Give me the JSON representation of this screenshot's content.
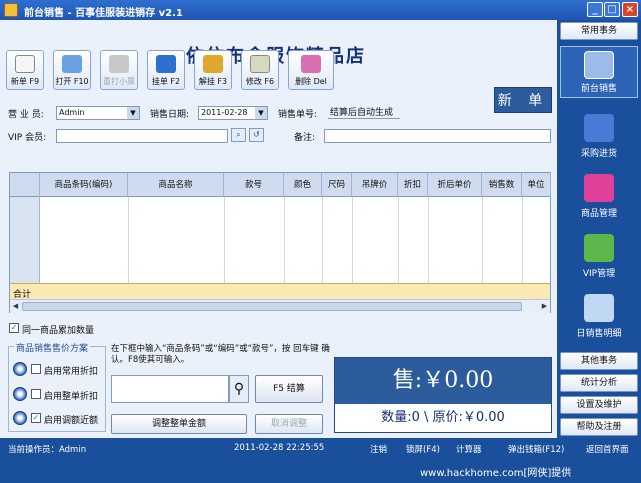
{
  "window": {
    "title": "前台销售 - 百事佳服装进销存 v2.1"
  },
  "shop_title": "依依布舍服饰精品店",
  "new_bill": "新 单",
  "toolbar": {
    "new": "新单 F9",
    "open": "打开 F10",
    "reprint": "重打小票",
    "hold": "挂单 F2",
    "unhold": "解挂 F3",
    "edit": "修改 F6",
    "delete": "删除 Del"
  },
  "form": {
    "salesperson_label": "营 业 员:",
    "salesperson_value": "Admin",
    "date_label": "销售日期:",
    "date_value": "2011-02-28",
    "bill_no_label": "销售单号:",
    "bill_no_value": "结算后自动生成",
    "vip_label": "VIP 会员:",
    "vip_value": "",
    "note_label": "备注:",
    "note_value": ""
  },
  "table": {
    "columns": [
      "商品条码(编码)",
      "商品名称",
      "款号",
      "颜色",
      "尺码",
      "吊牌价",
      "折扣",
      "折后单价",
      "销售数",
      "单位"
    ],
    "total_label": "合计"
  },
  "same_item_add": "同一商品累加数量",
  "scheme": {
    "title": "商品销售售价方案",
    "options": [
      {
        "label": "启用常用折扣",
        "checked": false
      },
      {
        "label": "启用整单折扣",
        "checked": false
      },
      {
        "label": "启用调额近额",
        "checked": true
      }
    ]
  },
  "hint": "在下框中输入“商品条码”或“编码”或“款号”，按 回车键 确认。F8使其可输入。",
  "buttons": {
    "checkout": "F5 结算",
    "adjust_total": "调整整单金额",
    "cancel_adjust": "取消调整"
  },
  "totals": {
    "sale_line": "售:￥0.00",
    "qty_line": "数量:0 \\ 原价:￥0.00"
  },
  "nav": {
    "common_tasks": "常用事务",
    "items": [
      "前台销售",
      "采购进货",
      "商品管理",
      "VIP管理",
      "日销售明细"
    ],
    "other_tasks": "其他事务",
    "stats": "统计分析",
    "settings": "设置及维护",
    "help": "帮助及注册"
  },
  "status": {
    "operator": "当前操作员：Admin",
    "datetime": "2011-02-28 22:25:55",
    "logout": "注销",
    "lock": "锁屏(F4)",
    "calc": "计算器",
    "cashbox": "弹出钱箱(F12)",
    "home": "返回首界面"
  },
  "watermark": "www.hackhome.com[网侠]提供",
  "colors": {
    "accent": "#1a4f9c",
    "panel": "#2d5c9d",
    "total_row": "#fbe9b3"
  },
  "icons": [
    "app-icon",
    "new-doc-icon",
    "open-folder-icon",
    "printer-icon",
    "lock-icon",
    "unlock-icon",
    "edit-icon",
    "delete-icon",
    "search-icon",
    "refresh-icon",
    "laptop-icon",
    "basket-icon",
    "tshirt-icon",
    "users-icon",
    "magnifier-icon"
  ]
}
